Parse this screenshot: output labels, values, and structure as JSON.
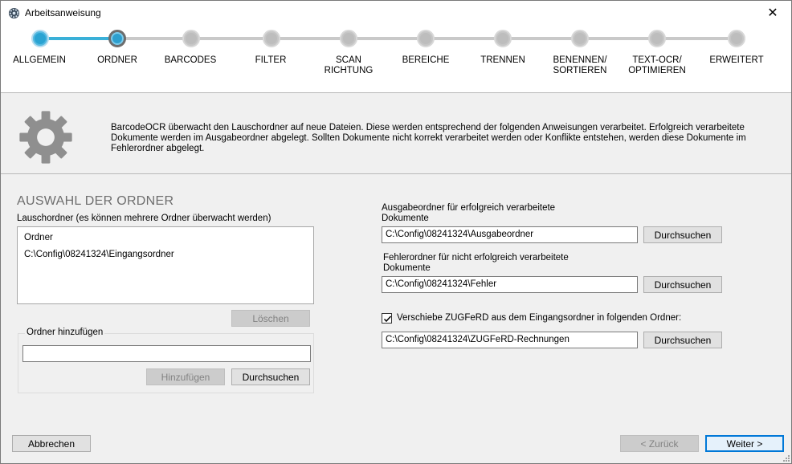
{
  "window": {
    "title": "Arbeitsanweisung",
    "close_symbol": "✕"
  },
  "colors": {
    "accent": "#2aa3d2",
    "primary_border": "#0078d7",
    "section_title": "#6e6e6e"
  },
  "stepper": {
    "steps": [
      {
        "label": "ALLGEMEIN",
        "state": "done"
      },
      {
        "label": "ORDNER",
        "state": "current"
      },
      {
        "label": "BARCODES",
        "state": "todo"
      },
      {
        "label": "FILTER",
        "state": "todo"
      },
      {
        "label": "SCAN\nRICHTUNG",
        "state": "todo"
      },
      {
        "label": "BEREICHE",
        "state": "todo"
      },
      {
        "label": "TRENNEN",
        "state": "todo"
      },
      {
        "label": "BENENNEN/\nSORTIEREN",
        "state": "todo"
      },
      {
        "label": "TEXT-OCR/\nOPTIMIEREN",
        "state": "todo"
      },
      {
        "label": "ERWEITERT",
        "state": "todo"
      }
    ]
  },
  "info": {
    "icon": "gear-icon",
    "text": "BarcodeOCR überwacht den Lauschordner auf neue Dateien. Diese werden entsprechend der folgenden Anweisungen verarbeitet. Erfolgreich verarbeitete Dokumente werden im Ausgabeordner abgelegt. Sollten Dokumente nicht korrekt verarbeitet werden oder Konflikte entstehen, werden diese Dokumente im Fehlerordner abgelegt."
  },
  "left": {
    "section_title": "AUSWAHL DER ORDNER",
    "watch_label": "Lauschordner (es können mehrere Ordner überwacht werden)",
    "list_header": "Ordner",
    "list_items": [
      "C:\\Config\\08241324\\Eingangsordner"
    ],
    "delete_button": "Löschen",
    "add_group_label": "Ordner hinzufügen",
    "add_input_value": "",
    "add_button": "Hinzufügen",
    "browse_button": "Durchsuchen"
  },
  "right": {
    "output_label": "Ausgabeordner für erfolgreich verarbeitete\nDokumente",
    "output_value": "C:\\Config\\08241324\\Ausgabeordner",
    "output_browse": "Durchsuchen",
    "error_label": "Fehlerordner für nicht erfolgreich verarbeitete\nDokumente",
    "error_value": "C:\\Config\\08241324\\Fehler",
    "error_browse": "Durchsuchen",
    "zugferd_checked": true,
    "zugferd_label": "Verschiebe ZUGFeRD aus dem Eingangsordner in folgenden Ordner:",
    "zugferd_value": "C:\\Config\\08241324\\ZUGFeRD-Rechnungen",
    "zugferd_browse": "Durchsuchen"
  },
  "footer": {
    "cancel_button": "Abbrechen",
    "back_button": "< Zurück",
    "next_button": "Weiter >"
  }
}
